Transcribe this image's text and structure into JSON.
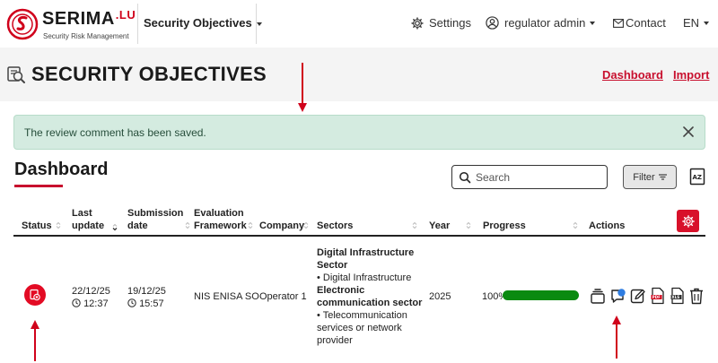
{
  "app": {
    "logo_name": "SERIMA",
    "logo_suffix": ".LU",
    "logo_subtitle": "Security Risk Management",
    "module": "Security Objectives"
  },
  "nav": {
    "settings": "Settings",
    "user": "regulator admin",
    "contact": "Contact",
    "language": "EN"
  },
  "page": {
    "title": "SECURITY OBJECTIVES",
    "link_dashboard": "Dashboard",
    "link_import": "Import"
  },
  "alert": {
    "message": "The review comment has been saved."
  },
  "dashboard": {
    "title": "Dashboard",
    "search_placeholder": "Search",
    "filter_label": "Filter"
  },
  "table": {
    "headers": {
      "status": "Status",
      "last_update_1": "Last",
      "last_update_2": "update",
      "submission_1": "Submission",
      "submission_2": "date",
      "framework_1": "Evaluation",
      "framework_2": "Framework",
      "company": "Company",
      "sectors": "Sectors",
      "year": "Year",
      "progress": "Progress",
      "actions": "Actions"
    },
    "rows": [
      {
        "last_update_date": "22/12/25",
        "last_update_time": "12:37",
        "submission_date": "19/12/25",
        "submission_time": "15:57",
        "framework": "NIS ENISA SO",
        "company": "Operator 1",
        "sector1_title_1": "Digital Infrastructure",
        "sector1_title_2": "Sector",
        "sector1_item": "• Digital Infrastructure",
        "sector2_title_1": "Electronic",
        "sector2_title_2": "communication sector",
        "sector2_item_1": "• Telecommunication",
        "sector2_item_2": "services or network",
        "sector2_item_3": "provider",
        "year": "2025",
        "progress_text": "100%",
        "progress_value": 100
      }
    ]
  },
  "colors": {
    "brand_red": "#d0021b",
    "alert_bg": "#d4ebe0",
    "progress_green": "#0a8a10",
    "comment_blue": "#2f7de1"
  },
  "icons": [
    "settings-gear-icon",
    "user-icon",
    "mail-icon",
    "search-icon",
    "filter-icon",
    "sort-az-icon",
    "close-icon",
    "status-rejected-icon",
    "history-icon",
    "comment-icon",
    "edit-icon",
    "pdf-icon",
    "export-icon",
    "delete-icon"
  ]
}
